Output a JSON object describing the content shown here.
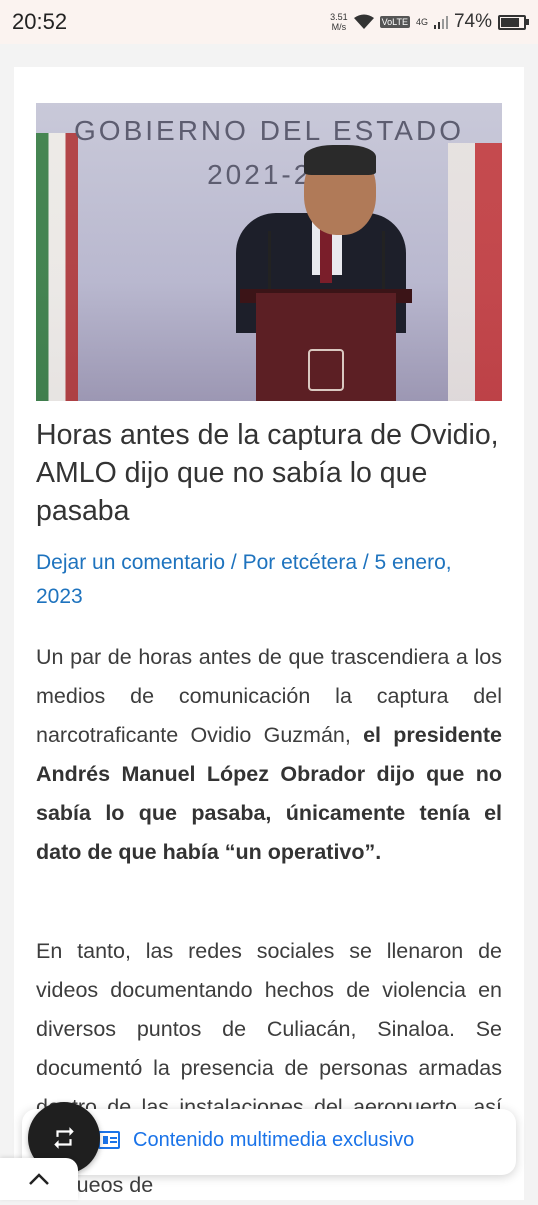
{
  "status_bar": {
    "time": "20:52",
    "net_speed": "3.51",
    "net_unit": "M/s",
    "volte": "VoLTE",
    "network": "4G",
    "battery_percent": "74%",
    "battery_level": 0.74
  },
  "article": {
    "hero_banner_text": "GOBIERNO DEL ESTADO",
    "hero_banner_years": "2021-20",
    "title": "Horas antes de la captura de Ovidio, AMLO dijo que no sabía lo que pasaba",
    "meta": {
      "comments": "Dejar un comentario",
      "sep1": " / Por ",
      "author": "etcétera",
      "sep2": " / ",
      "date": "5 enero, 2023"
    },
    "p1_normal": "Un par de horas antes de que trascendiera a los medios de comunicación la captura del narcotraficante Ovidio Guzmán, ",
    "p1_bold": "el presidente Andrés Manuel López Obrador dijo que no sabía lo que pasaba, únicamente tenía el dato de que había “un operativo”.",
    "p2": "En tanto, las redes sociales se llenaron de videos documentando hechos de violencia en diversos puntos de Culiacán, Sinaloa. Se documentó la presencia de personas armadas dentro de las instalaciones del aeropuerto, así como personas realizando ataques a fuego, bloqueos de"
  },
  "floating_bar": {
    "label": "Contenido multimedia exclusivo"
  },
  "icons": {
    "fab": "repeat-icon",
    "bar": "newspaper-icon",
    "up": "chevron-up-icon"
  },
  "colors": {
    "link": "#1e73be",
    "accent": "#1a73e8",
    "fab": "#1f1f1f"
  }
}
